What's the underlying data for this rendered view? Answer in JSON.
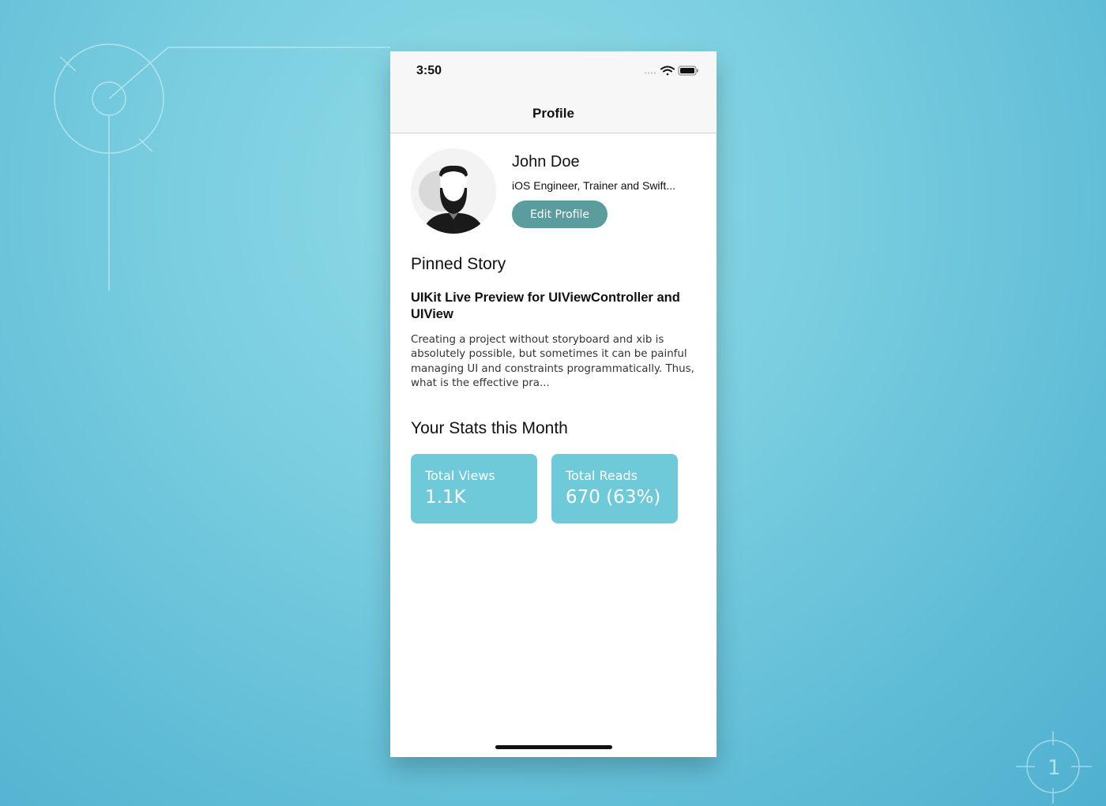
{
  "status_bar": {
    "time": "3:50"
  },
  "nav": {
    "title": "Profile"
  },
  "profile": {
    "name": "John Doe",
    "bio": "iOS Engineer, Trainer and Swift...",
    "edit_button_label": "Edit Profile",
    "avatar_icon": "bearded-man-avatar"
  },
  "pinned_story": {
    "section_title": "Pinned Story",
    "title": "UIKit Live Preview for UIViewController and UIView",
    "body": "Creating a project without storyboard and xib is absolutely possible, but sometimes it can be painful managing UI and constraints programmatically. Thus, what is the effective pra..."
  },
  "stats": {
    "section_title": "Your Stats this Month",
    "cards": [
      {
        "label": "Total Views",
        "value": "1.1K"
      },
      {
        "label": "Total Reads",
        "value": "670 (63%)"
      }
    ]
  },
  "background_badge": "1",
  "colors": {
    "accent_button": "#5b9d9f",
    "stat_card": "#6ecad9",
    "background": "#7ccfe0"
  }
}
